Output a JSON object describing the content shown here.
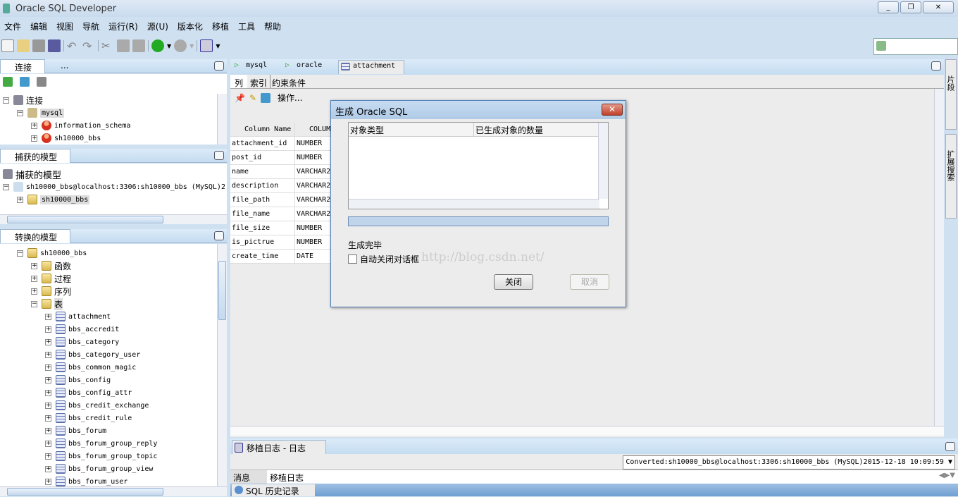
{
  "window": {
    "title": "Oracle SQL Developer",
    "min": "_",
    "restore": "❐",
    "close": "✕"
  },
  "menu": [
    "文件",
    "编辑",
    "视图",
    "导航",
    "运行(R)",
    "源(U)",
    "版本化",
    "移植",
    "工具",
    "帮助"
  ],
  "toolbar": {
    "icons": [
      "new-icon",
      "open-icon",
      "save-icon",
      "save-all-icon",
      "undo-icon",
      "redo-icon",
      "cut-icon",
      "copy-icon",
      "paste-icon",
      "back-icon",
      "forward-icon",
      "sql-worksheet-icon"
    ]
  },
  "connections": {
    "tab": "连接",
    "tab2": "...",
    "root": "连接",
    "items": [
      "mysql",
      "information_schema",
      "sh10000_bbs"
    ]
  },
  "captured": {
    "tab": "捕获的模型",
    "root": "捕获的模型",
    "conn": "sh10000_bbs@localhost:3306:sh10000_bbs (MySQL)2",
    "schema": "sh10000_bbs"
  },
  "converted": {
    "tab": "转换的模型",
    "schema": "sh10000_bbs",
    "folders": [
      "函数",
      "过程",
      "序列",
      "表"
    ],
    "tables": [
      "attachment",
      "bbs_accredit",
      "bbs_category",
      "bbs_category_user",
      "bbs_common_magic",
      "bbs_config",
      "bbs_config_attr",
      "bbs_credit_exchange",
      "bbs_credit_rule",
      "bbs_forum",
      "bbs_forum_group_reply",
      "bbs_forum_group_topic",
      "bbs_forum_group_view",
      "bbs_forum_user"
    ]
  },
  "editor": {
    "tabs": [
      "mysql",
      "oracle",
      "attachment"
    ],
    "subtabs": [
      "列",
      "索引",
      "约束条件"
    ],
    "actions": "操作...",
    "headers": [
      "Column Name",
      "COLUMN"
    ],
    "rows": [
      [
        "attachment_id",
        "NUMBER"
      ],
      [
        "post_id",
        "NUMBER"
      ],
      [
        "name",
        "VARCHAR2"
      ],
      [
        "description",
        "VARCHAR2"
      ],
      [
        "file_path",
        "VARCHAR2"
      ],
      [
        "file_name",
        "VARCHAR2"
      ],
      [
        "file_size",
        "NUMBER"
      ],
      [
        "is_pictrue",
        "NUMBER"
      ],
      [
        "create_time",
        "DATE"
      ]
    ]
  },
  "dialog": {
    "title": "生成 Oracle SQL",
    "headers": [
      "对象类型",
      "已生成对象的数量"
    ],
    "progress": 0,
    "status": "生成完毕",
    "checkbox": "自动关闭对话框",
    "checked": false,
    "close": "关闭",
    "cancel": "取消",
    "watermark": "http://blog.csdn.net/"
  },
  "log": {
    "tab": "移植日志 - 日志",
    "select": "Converted:sh10000_bbs@localhost:3306:sh10000_bbs (MySQL)2015-12-18 10:09:59",
    "tabs": [
      "消息",
      "移植日志"
    ],
    "history": "SQL 历史记录"
  },
  "rightbar": [
    "片段",
    "扩展搜索"
  ]
}
